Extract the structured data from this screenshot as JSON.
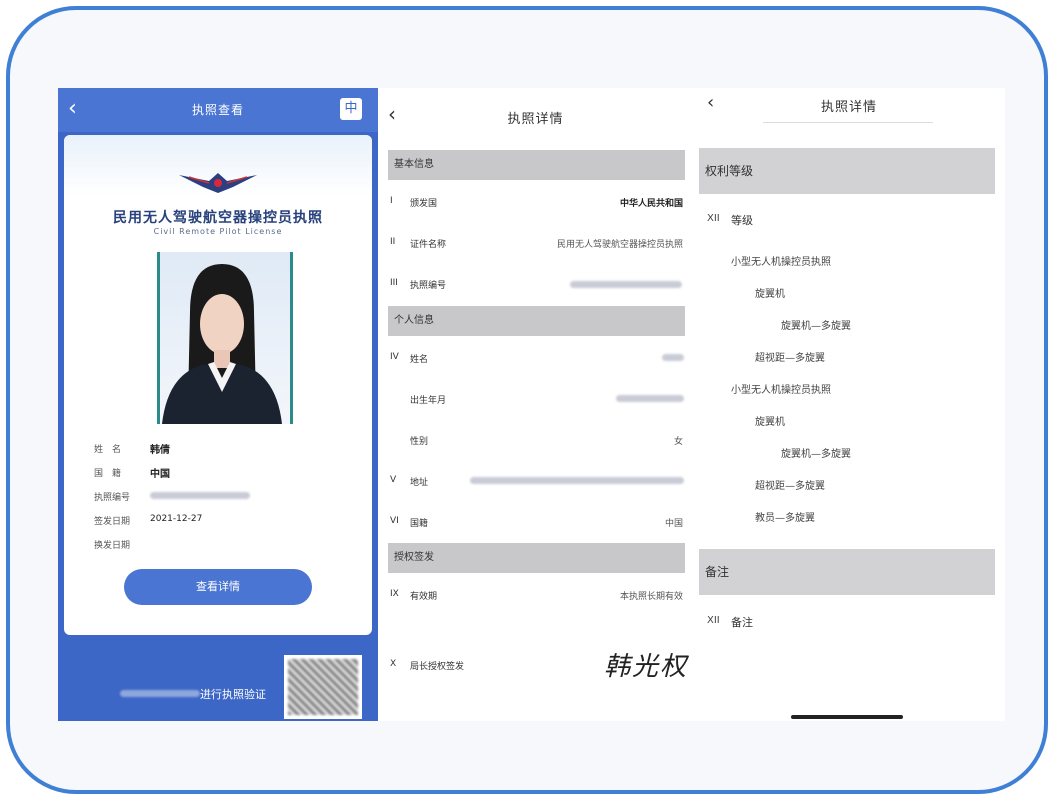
{
  "panel1": {
    "back": "‹",
    "title": "执照查看",
    "lang_icon": "中",
    "card_title": "民用无人驾驶航空器操控员执照",
    "card_subtitle": "Civil Remote Pilot License",
    "fields": [
      {
        "label": "姓　名",
        "value": "韩倩"
      },
      {
        "label": "国　籍",
        "value": "中国"
      },
      {
        "label": "执照编号",
        "value": ""
      },
      {
        "label": "签发日期",
        "value": "2021-12-27"
      },
      {
        "label": "换发日期",
        "value": ""
      }
    ],
    "detail_button": "查看详情",
    "verify_text": "进行执照验证"
  },
  "panel2": {
    "back": "‹",
    "title": "执照详情",
    "sections": [
      {
        "title": "基本信息"
      },
      {
        "title": "个人信息"
      },
      {
        "title": "授权签发"
      }
    ],
    "rows": [
      {
        "num": "I",
        "label": "颁发国",
        "value": "中华人民共和国"
      },
      {
        "num": "II",
        "label": "证件名称",
        "value": "民用无人驾驶航空器操控员执照"
      },
      {
        "num": "III",
        "label": "执照编号",
        "value": ""
      },
      {
        "num": "IV",
        "label": "姓名",
        "value": ""
      },
      {
        "num": "",
        "label": "出生年月",
        "value": ""
      },
      {
        "num": "",
        "label": "性别",
        "value": "女"
      },
      {
        "num": "V",
        "label": "地址",
        "value": ""
      },
      {
        "num": "VI",
        "label": "国籍",
        "value": "中国"
      },
      {
        "num": "IX",
        "label": "有效期",
        "value": "本执照长期有效"
      },
      {
        "num": "X",
        "label": "局长授权签发",
        "value": ""
      }
    ],
    "signature": "韩光权"
  },
  "panel3": {
    "back": "‹",
    "title": "执照详情",
    "section1": "权利等级",
    "grade_num": "XII",
    "grade_label": "等级",
    "tree": [
      {
        "text": "小型无人机操控员执照",
        "level": 0
      },
      {
        "text": "旋翼机",
        "level": 1
      },
      {
        "text": "旋翼机—多旋翼",
        "level": 2
      },
      {
        "text": "超视距—多旋翼",
        "level": 1
      },
      {
        "text": "小型无人机操控员执照",
        "level": 0
      },
      {
        "text": "旋翼机",
        "level": 1
      },
      {
        "text": "旋翼机—多旋翼",
        "level": 2
      },
      {
        "text": "超视距—多旋翼",
        "level": 1
      },
      {
        "text": "教员—多旋翼",
        "level": 1
      }
    ],
    "section2": "备注",
    "remark_num": "XII",
    "remark_label": "备注"
  },
  "colors": {
    "frame": "#3f7fd6",
    "brand_blue": "#3c67c6",
    "section_gray": "#c8c8ca"
  }
}
